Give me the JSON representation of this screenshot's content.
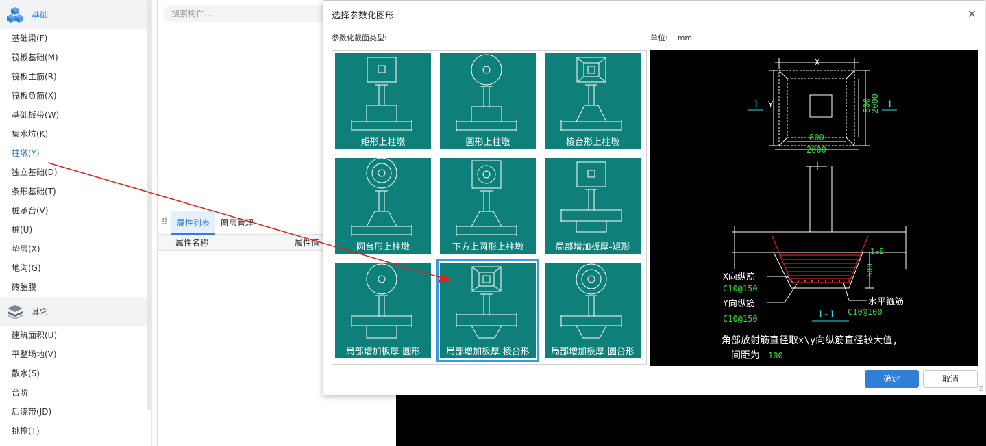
{
  "sidebar": {
    "cat_jichu": "基础",
    "jichu_items": [
      "基础梁(F)",
      "筏板基础(M)",
      "筏板主筋(R)",
      "筏板负筋(X)",
      "基础板带(W)",
      "集水坑(K)",
      "柱墩(Y)",
      "独立基础(D)",
      "条形基础(T)",
      "桩承台(V)",
      "桩(U)",
      "垫层(X)",
      "地沟(G)",
      "砖胎膜"
    ],
    "cat_other": "其它",
    "other_items": [
      "建筑面积(U)",
      "平整场地(V)",
      "散水(S)",
      "台阶",
      "后浇带(JD)",
      "挑檐(T)"
    ]
  },
  "mid": {
    "search_placeholder": "搜索构件...",
    "tab_props": "属性列表",
    "tab_layers": "图层管理",
    "col_name": "属性名称",
    "col_value": "属性值"
  },
  "dialog": {
    "title": "选择参数化图形",
    "close": "✕",
    "type_label": "参数化截面类型:",
    "unit_label": "单位:",
    "unit_value": "mm",
    "shapes": [
      "矩形上柱墩",
      "圆形上柱墩",
      "棱台形上柱墩",
      "圆台形上柱墩",
      "下方上圆形上柱墩",
      "局部增加板厚-矩形",
      "局部增加板厚-圆形",
      "局部增加板厚-棱台形",
      "局部增加板厚-圆台形"
    ],
    "selected_index": 7,
    "ok": "确定",
    "cancel": "取消"
  },
  "preview": {
    "dim_x": "X",
    "dim_y": "Y",
    "dim_800a": "800",
    "dim_2000a": "2000",
    "dim_800b": "800",
    "dim_2000b": "2000",
    "sec_left": "1",
    "sec_right": "1",
    "label_lae": "1aE",
    "dim_600": "600",
    "x_bar": "X向纵筋",
    "x_bar_spec": "C10@150",
    "y_bar": "Y向纵筋",
    "y_bar_spec": "C10@150",
    "h_stirrup": "水平箍筋",
    "h_stirrup_spec": "C10@100",
    "section_tag": "1-1",
    "note_line1": "角部放射筋直径取x\\y向纵筋直径较大值,",
    "note_line2": "间距为",
    "note_spacing": "100"
  },
  "colors": {
    "teal": "#0e8079",
    "accent": "#2f7fd8",
    "select": "#3a9be0",
    "rebar": "#e0201a",
    "cyan": "#33d6e6",
    "green": "#3bd63b"
  }
}
